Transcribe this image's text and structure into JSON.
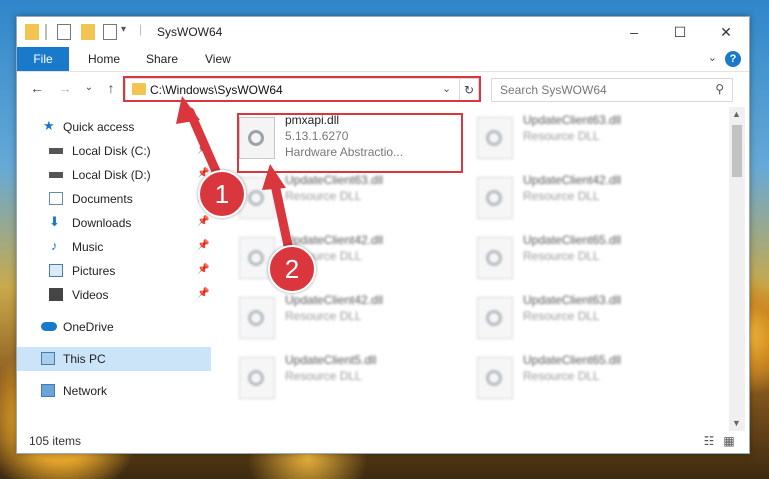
{
  "window": {
    "title": "SysWOW64"
  },
  "ribbon": {
    "tabs": [
      "File",
      "Home",
      "Share",
      "View"
    ]
  },
  "nav": {
    "address": "C:\\Windows\\SysWOW64",
    "search_placeholder": "Search SysWOW64"
  },
  "sidebar": {
    "items": [
      {
        "label": "Quick access",
        "icon": "star-icon"
      },
      {
        "label": "Local Disk (C:)",
        "icon": "drive-icon"
      },
      {
        "label": "Local Disk (D:)",
        "icon": "drive-icon"
      },
      {
        "label": "Documents",
        "icon": "documents-icon"
      },
      {
        "label": "Downloads",
        "icon": "download-icon"
      },
      {
        "label": "Music",
        "icon": "music-icon"
      },
      {
        "label": "Pictures",
        "icon": "pictures-icon"
      },
      {
        "label": "Videos",
        "icon": "videos-icon"
      },
      {
        "label": "OneDrive",
        "icon": "cloud-icon"
      },
      {
        "label": "This PC",
        "icon": "computer-icon"
      },
      {
        "label": "Network",
        "icon": "network-icon"
      }
    ]
  },
  "files": [
    {
      "name": "pmxapi.dll",
      "version": "5.13.1.6270",
      "desc": "Hardware Abstractio..."
    },
    {
      "name": "UpdateClient63.dll",
      "desc": "Resource DLL"
    },
    {
      "name": "UpdateClient63.dll",
      "desc": "Resource DLL"
    },
    {
      "name": "UpdateClient42.dll",
      "desc": "Resource DLL"
    },
    {
      "name": "UpdateClient42.dll",
      "desc": "Resource DLL"
    },
    {
      "name": "UpdateClient65.dll",
      "desc": "Resource DLL"
    },
    {
      "name": "UpdateClient42.dll",
      "desc": "Resource DLL"
    },
    {
      "name": "UpdateClient63.dll",
      "desc": "Resource DLL"
    },
    {
      "name": "UpdateClient5.dll",
      "desc": "Resource DLL"
    },
    {
      "name": "UpdateClient65.dll",
      "desc": "Resource DLL"
    }
  ],
  "status": {
    "count": "105 items"
  },
  "annotations": {
    "step1": "1",
    "step2": "2",
    "highlight_color": "#d9363e"
  }
}
